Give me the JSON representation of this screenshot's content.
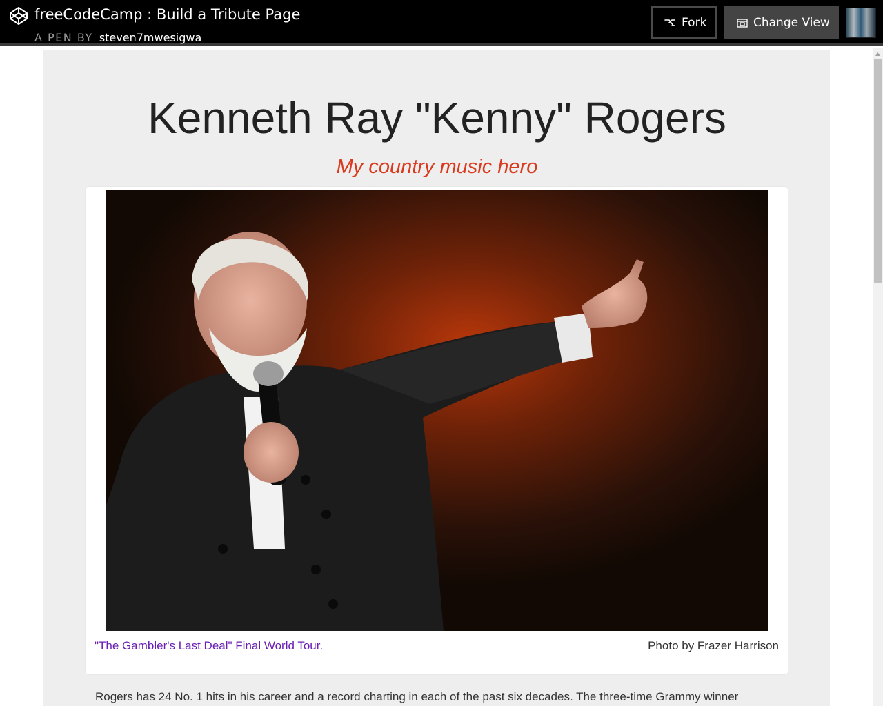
{
  "header": {
    "logo_icon": "codepen-icon",
    "pen_title": "freeCodeCamp : Build a Tribute Page",
    "pen_by_label": "A PEN BY",
    "author": "steven7mwesigwa",
    "fork_label": "Fork",
    "fork_icon": "fork-icon",
    "change_view_label": "Change View",
    "change_view_icon": "layout-icon"
  },
  "tribute": {
    "title": "Kenneth Ray \"Kenny\" Rogers",
    "subtitle": "My country music hero",
    "image_alt": "Kenny Rogers singing into a microphone and pointing",
    "caption": "\"The Gambler's Last Deal\" Final World Tour.",
    "credit": "Photo by Frazer Harrison",
    "bio_first_line": "Rogers has 24 No. 1 hits in his career and a record charting in each of the past six decades. The three-time Grammy winner"
  },
  "colors": {
    "header_bg": "#000000",
    "content_bg": "#eeeeee",
    "subtitle": "#d9391c",
    "caption_link": "#6a1fb5"
  }
}
